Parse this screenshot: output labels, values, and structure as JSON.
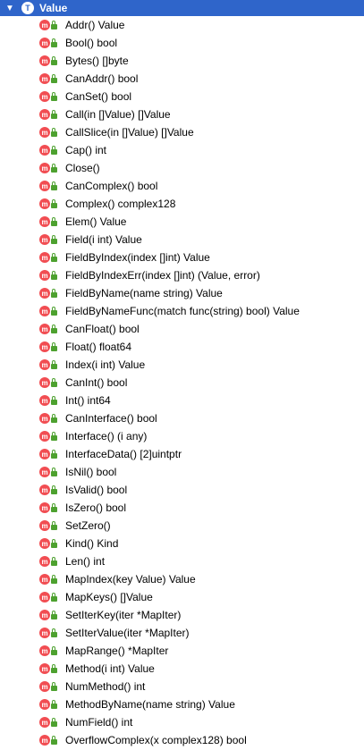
{
  "header": {
    "chevron_icon": "chevron-down-icon",
    "type_icon_letter": "T",
    "title": "Value"
  },
  "method_icon_letter": "m",
  "methods": [
    "Addr() Value",
    "Bool() bool",
    "Bytes() []byte",
    "CanAddr() bool",
    "CanSet() bool",
    "Call(in []Value) []Value",
    "CallSlice(in []Value) []Value",
    "Cap() int",
    "Close()",
    "CanComplex() bool",
    "Complex() complex128",
    "Elem() Value",
    "Field(i int) Value",
    "FieldByIndex(index []int) Value",
    "FieldByIndexErr(index []int) (Value, error)",
    "FieldByName(name string) Value",
    "FieldByNameFunc(match func(string) bool) Value",
    "CanFloat() bool",
    "Float() float64",
    "Index(i int) Value",
    "CanInt() bool",
    "Int() int64",
    "CanInterface() bool",
    "Interface() (i any)",
    "InterfaceData() [2]uintptr",
    "IsNil() bool",
    "IsValid() bool",
    "IsZero() bool",
    "SetZero()",
    "Kind() Kind",
    "Len() int",
    "MapIndex(key Value) Value",
    "MapKeys() []Value",
    "SetIterKey(iter *MapIter)",
    "SetIterValue(iter *MapIter)",
    "MapRange() *MapIter",
    "Method(i int) Value",
    "NumMethod() int",
    "MethodByName(name string) Value",
    "NumField() int",
    "OverflowComplex(x complex128) bool"
  ]
}
